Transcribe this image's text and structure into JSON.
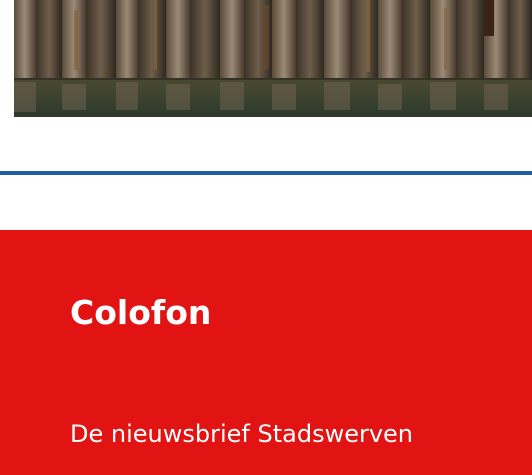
{
  "image": {
    "subject": "photo"
  },
  "colofon": {
    "title": "Colofon",
    "body_line_1": "De nieuwsbrief Stadswerven",
    "body_line_2": "..."
  },
  "colors": {
    "divider": "#1e5fa8",
    "colofon_background": "#e21313",
    "colofon_text": "#ffffff"
  }
}
